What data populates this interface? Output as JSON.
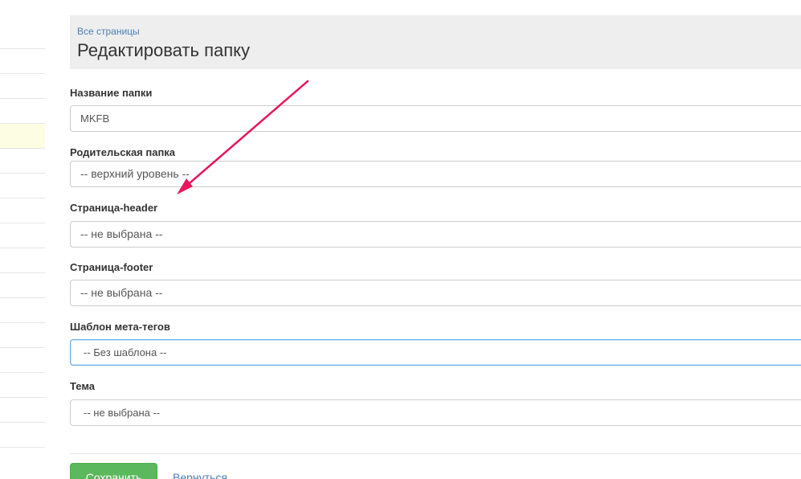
{
  "header": {
    "breadcrumb": "Все страницы",
    "title": "Редактировать папку"
  },
  "form": {
    "folder_name": {
      "label": "Название папки",
      "value": "MKFB"
    },
    "parent_folder": {
      "label": "Родительская папка",
      "value": "-- верхний уровень --"
    },
    "header_page": {
      "label": "Страница-header",
      "value": "-- не выбрана --"
    },
    "footer_page": {
      "label": "Страница-footer",
      "value": "-- не выбрана --"
    },
    "meta_template": {
      "label": "Шаблон мета-тегов",
      "value": "-- Без шаблона --"
    },
    "theme": {
      "label": "Тема",
      "value": "-- не выбрана --"
    }
  },
  "actions": {
    "save_label": "Сохранить",
    "back_label": "Вернуться"
  },
  "colors": {
    "annotation_arrow": "#e8175d",
    "save_button": "#5cb85c",
    "link": "#4a7fb5"
  }
}
